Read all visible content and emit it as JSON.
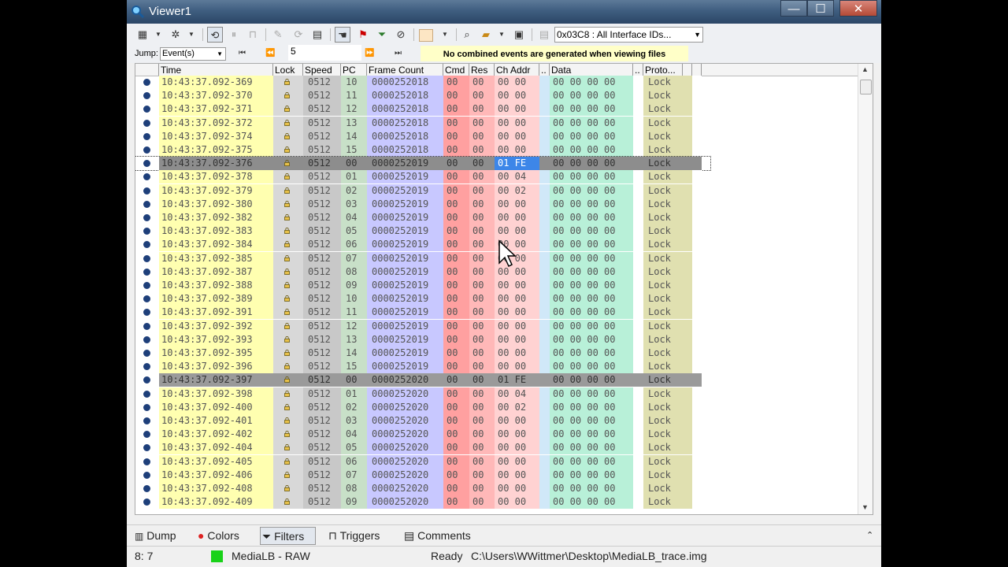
{
  "window": {
    "title": "Viewer1",
    "minimize": "—",
    "maximize": "☐",
    "close": "✕"
  },
  "toolbar": {
    "interface_select": "0x03C8 : All Interface IDs...",
    "jump_label": "Jump:",
    "jump_type": "Event(s)",
    "jump_value": "5",
    "notice": "No combined events are generated when viewing files"
  },
  "columns": [
    "Time",
    "Lock",
    "Speed",
    "PC",
    "Frame Count",
    "Cmd",
    "Res",
    "Ch Addr",
    "..",
    "Data",
    "..",
    "Proto..."
  ],
  "column_colors": {
    "time": "#ffffb0",
    "lock": "#d8d8d8",
    "speed": "#c8c8c8",
    "pc": "#c8e0c8",
    "frame": "#c8c8ff",
    "cmd": "#ffa0a0",
    "res": "#ffb8b8",
    "chaddr": "#ffd2d2",
    "data": "#b8f0d8",
    "proto": "#e0e0b0"
  },
  "rows": [
    {
      "time": "10:43:37.092-369",
      "speed": "0512",
      "pc": "10",
      "frame": "0000252018",
      "cmd": "00",
      "res": "00",
      "ch": "00 00",
      "data": "00 00 00 00",
      "proto": "Lock"
    },
    {
      "time": "10:43:37.092-370",
      "speed": "0512",
      "pc": "11",
      "frame": "0000252018",
      "cmd": "00",
      "res": "00",
      "ch": "00 00",
      "data": "00 00 00 00",
      "proto": "Lock"
    },
    {
      "time": "10:43:37.092-371",
      "speed": "0512",
      "pc": "12",
      "frame": "0000252018",
      "cmd": "00",
      "res": "00",
      "ch": "00 00",
      "data": "00 00 00 00",
      "proto": "Lock"
    },
    {
      "time": "10:43:37.092-372",
      "speed": "0512",
      "pc": "13",
      "frame": "0000252018",
      "cmd": "00",
      "res": "00",
      "ch": "00 00",
      "data": "00 00 00 00",
      "proto": "Lock"
    },
    {
      "time": "10:43:37.092-374",
      "speed": "0512",
      "pc": "14",
      "frame": "0000252018",
      "cmd": "00",
      "res": "00",
      "ch": "00 00",
      "data": "00 00 00 00",
      "proto": "Lock"
    },
    {
      "time": "10:43:37.092-375",
      "speed": "0512",
      "pc": "15",
      "frame": "0000252018",
      "cmd": "00",
      "res": "00",
      "ch": "00 00",
      "data": "00 00 00 00",
      "proto": "Lock"
    },
    {
      "time": "10:43:37.092-376",
      "speed": "0512",
      "pc": "00",
      "frame": "0000252019",
      "cmd": "00",
      "res": "00",
      "ch": "01 FE",
      "data": "00 00 00 00",
      "proto": "Lock",
      "sel": 1
    },
    {
      "time": "10:43:37.092-378",
      "speed": "0512",
      "pc": "01",
      "frame": "0000252019",
      "cmd": "00",
      "res": "00",
      "ch": "00 04",
      "data": "00 00 00 00",
      "proto": "Lock"
    },
    {
      "time": "10:43:37.092-379",
      "speed": "0512",
      "pc": "02",
      "frame": "0000252019",
      "cmd": "00",
      "res": "00",
      "ch": "00 02",
      "data": "00 00 00 00",
      "proto": "Lock"
    },
    {
      "time": "10:43:37.092-380",
      "speed": "0512",
      "pc": "03",
      "frame": "0000252019",
      "cmd": "00",
      "res": "00",
      "ch": "00 00",
      "data": "00 00 00 00",
      "proto": "Lock"
    },
    {
      "time": "10:43:37.092-382",
      "speed": "0512",
      "pc": "04",
      "frame": "0000252019",
      "cmd": "00",
      "res": "00",
      "ch": "00 00",
      "data": "00 00 00 00",
      "proto": "Lock"
    },
    {
      "time": "10:43:37.092-383",
      "speed": "0512",
      "pc": "05",
      "frame": "0000252019",
      "cmd": "00",
      "res": "00",
      "ch": "00 00",
      "data": "00 00 00 00",
      "proto": "Lock"
    },
    {
      "time": "10:43:37.092-384",
      "speed": "0512",
      "pc": "06",
      "frame": "0000252019",
      "cmd": "00",
      "res": "00",
      "ch": "00 00",
      "data": "00 00 00 00",
      "proto": "Lock"
    },
    {
      "time": "10:43:37.092-385",
      "speed": "0512",
      "pc": "07",
      "frame": "0000252019",
      "cmd": "00",
      "res": "00",
      "ch": "00 00",
      "data": "00 00 00 00",
      "proto": "Lock"
    },
    {
      "time": "10:43:37.092-387",
      "speed": "0512",
      "pc": "08",
      "frame": "0000252019",
      "cmd": "00",
      "res": "00",
      "ch": "00 00",
      "data": "00 00 00 00",
      "proto": "Lock"
    },
    {
      "time": "10:43:37.092-388",
      "speed": "0512",
      "pc": "09",
      "frame": "0000252019",
      "cmd": "00",
      "res": "00",
      "ch": "00 00",
      "data": "00 00 00 00",
      "proto": "Lock"
    },
    {
      "time": "10:43:37.092-389",
      "speed": "0512",
      "pc": "10",
      "frame": "0000252019",
      "cmd": "00",
      "res": "00",
      "ch": "00 00",
      "data": "00 00 00 00",
      "proto": "Lock"
    },
    {
      "time": "10:43:37.092-391",
      "speed": "0512",
      "pc": "11",
      "frame": "0000252019",
      "cmd": "00",
      "res": "00",
      "ch": "00 00",
      "data": "00 00 00 00",
      "proto": "Lock"
    },
    {
      "time": "10:43:37.092-392",
      "speed": "0512",
      "pc": "12",
      "frame": "0000252019",
      "cmd": "00",
      "res": "00",
      "ch": "00 00",
      "data": "00 00 00 00",
      "proto": "Lock"
    },
    {
      "time": "10:43:37.092-393",
      "speed": "0512",
      "pc": "13",
      "frame": "0000252019",
      "cmd": "00",
      "res": "00",
      "ch": "00 00",
      "data": "00 00 00 00",
      "proto": "Lock"
    },
    {
      "time": "10:43:37.092-395",
      "speed": "0512",
      "pc": "14",
      "frame": "0000252019",
      "cmd": "00",
      "res": "00",
      "ch": "00 00",
      "data": "00 00 00 00",
      "proto": "Lock"
    },
    {
      "time": "10:43:37.092-396",
      "speed": "0512",
      "pc": "15",
      "frame": "0000252019",
      "cmd": "00",
      "res": "00",
      "ch": "00 00",
      "data": "00 00 00 00",
      "proto": "Lock"
    },
    {
      "time": "10:43:37.092-397",
      "speed": "0512",
      "pc": "00",
      "frame": "0000252020",
      "cmd": "00",
      "res": "00",
      "ch": "01 FE",
      "data": "00 00 00 00",
      "proto": "Lock",
      "sel": 2
    },
    {
      "time": "10:43:37.092-398",
      "speed": "0512",
      "pc": "01",
      "frame": "0000252020",
      "cmd": "00",
      "res": "00",
      "ch": "00 04",
      "data": "00 00 00 00",
      "proto": "Lock"
    },
    {
      "time": "10:43:37.092-400",
      "speed": "0512",
      "pc": "02",
      "frame": "0000252020",
      "cmd": "00",
      "res": "00",
      "ch": "00 02",
      "data": "00 00 00 00",
      "proto": "Lock"
    },
    {
      "time": "10:43:37.092-401",
      "speed": "0512",
      "pc": "03",
      "frame": "0000252020",
      "cmd": "00",
      "res": "00",
      "ch": "00 00",
      "data": "00 00 00 00",
      "proto": "Lock"
    },
    {
      "time": "10:43:37.092-402",
      "speed": "0512",
      "pc": "04",
      "frame": "0000252020",
      "cmd": "00",
      "res": "00",
      "ch": "00 00",
      "data": "00 00 00 00",
      "proto": "Lock"
    },
    {
      "time": "10:43:37.092-404",
      "speed": "0512",
      "pc": "05",
      "frame": "0000252020",
      "cmd": "00",
      "res": "00",
      "ch": "00 00",
      "data": "00 00 00 00",
      "proto": "Lock"
    },
    {
      "time": "10:43:37.092-405",
      "speed": "0512",
      "pc": "06",
      "frame": "0000252020",
      "cmd": "00",
      "res": "00",
      "ch": "00 00",
      "data": "00 00 00 00",
      "proto": "Lock"
    },
    {
      "time": "10:43:37.092-406",
      "speed": "0512",
      "pc": "07",
      "frame": "0000252020",
      "cmd": "00",
      "res": "00",
      "ch": "00 00",
      "data": "00 00 00 00",
      "proto": "Lock"
    },
    {
      "time": "10:43:37.092-408",
      "speed": "0512",
      "pc": "08",
      "frame": "0000252020",
      "cmd": "00",
      "res": "00",
      "ch": "00 00",
      "data": "00 00 00 00",
      "proto": "Lock"
    },
    {
      "time": "10:43:37.092-409",
      "speed": "0512",
      "pc": "09",
      "frame": "0000252020",
      "cmd": "00",
      "res": "00",
      "ch": "00 00",
      "data": "00 00 00 00",
      "proto": "Lock"
    }
  ],
  "bottom_tabs": [
    "Dump",
    "Colors",
    "Filters",
    "Triggers",
    "Comments"
  ],
  "active_tab": "Filters",
  "status": {
    "position": "8: 7",
    "device": "MediaLB - RAW",
    "state": "Ready",
    "file": "C:\\Users\\WWittmer\\Desktop\\MediaLB_trace.img"
  }
}
